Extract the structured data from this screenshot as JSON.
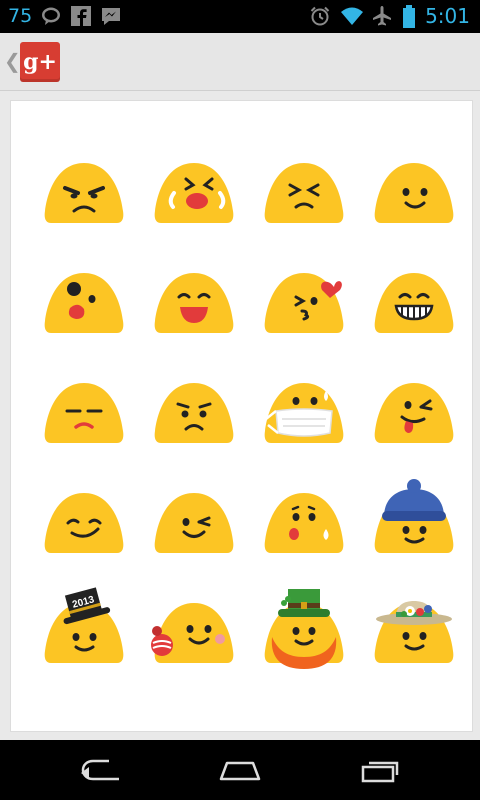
{
  "status_bar": {
    "notification_count": "75",
    "time": "5:01",
    "left_icons": [
      "chat-bubble-icon",
      "facebook-icon",
      "messenger-icon"
    ],
    "right_icons": [
      "alarm-icon",
      "wifi-icon",
      "airplane-mode-icon",
      "battery-icon"
    ]
  },
  "action_bar": {
    "app_logo_text": "g+"
  },
  "sticker_grid": {
    "rows": [
      [
        "angry-face-icon",
        "crying-face-icon",
        "frustrated-face-icon",
        "smiling-face-icon"
      ],
      [
        "bruised-face-icon",
        "laughing-face-icon",
        "kissing-face-icon",
        "grinning-face-icon"
      ],
      [
        "unamused-face-icon",
        "sad-face-icon",
        "masked-face-icon",
        "tongue-wink-face-icon"
      ],
      [
        "content-face-icon",
        "winking-face-icon",
        "surprised-sweat-face-icon",
        "winter-hat-face-icon"
      ],
      [
        "new-year-hat-face-icon",
        "apple-face-icon",
        "leprechaun-face-icon",
        "flower-hat-face-icon"
      ]
    ],
    "hat_text": "2013"
  },
  "nav_bar": {
    "buttons": [
      "back-icon",
      "home-icon",
      "recent-apps-icon"
    ]
  },
  "colors": {
    "accent": "#33b5e5",
    "emoji_yellow": "#fcc524",
    "google_plus_red": "#d73d32"
  }
}
